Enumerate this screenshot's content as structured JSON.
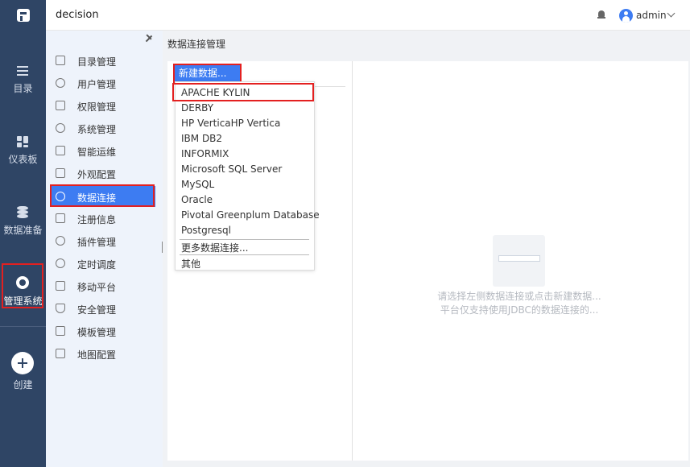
{
  "header": {
    "app_title": "decision",
    "username": "admin"
  },
  "rail": {
    "items": [
      {
        "label": "目录"
      },
      {
        "label": "仪表板"
      },
      {
        "label": "数据准备"
      },
      {
        "label": "管理系统"
      }
    ],
    "create_label": "创建"
  },
  "sidebar": {
    "items": [
      {
        "label": "目录管理"
      },
      {
        "label": "用户管理"
      },
      {
        "label": "权限管理"
      },
      {
        "label": "系统管理"
      },
      {
        "label": "智能运维"
      },
      {
        "label": "外观配置"
      },
      {
        "label": "数据连接"
      },
      {
        "label": "注册信息"
      },
      {
        "label": "插件管理"
      },
      {
        "label": "定时调度"
      },
      {
        "label": "移动平台"
      },
      {
        "label": "安全管理"
      },
      {
        "label": "模板管理"
      },
      {
        "label": "地图配置"
      }
    ]
  },
  "content": {
    "breadcrumb": "数据连接管理",
    "new_button_label": "新建数据...",
    "dropdown_items": [
      "APACHE KYLIN",
      "DERBY",
      "HP VerticaHP Vertica",
      "IBM DB2",
      "INFORMIX",
      "Microsoft SQL Server",
      "MySQL",
      "Oracle",
      "Pivotal Greenplum Database",
      "Postgresql",
      "更多数据连接...",
      "其他"
    ],
    "empty_line1": "请选择左侧数据连接或点击新建数据...",
    "empty_line2": "平台仅支持使用JDBC的数据连接的..."
  }
}
